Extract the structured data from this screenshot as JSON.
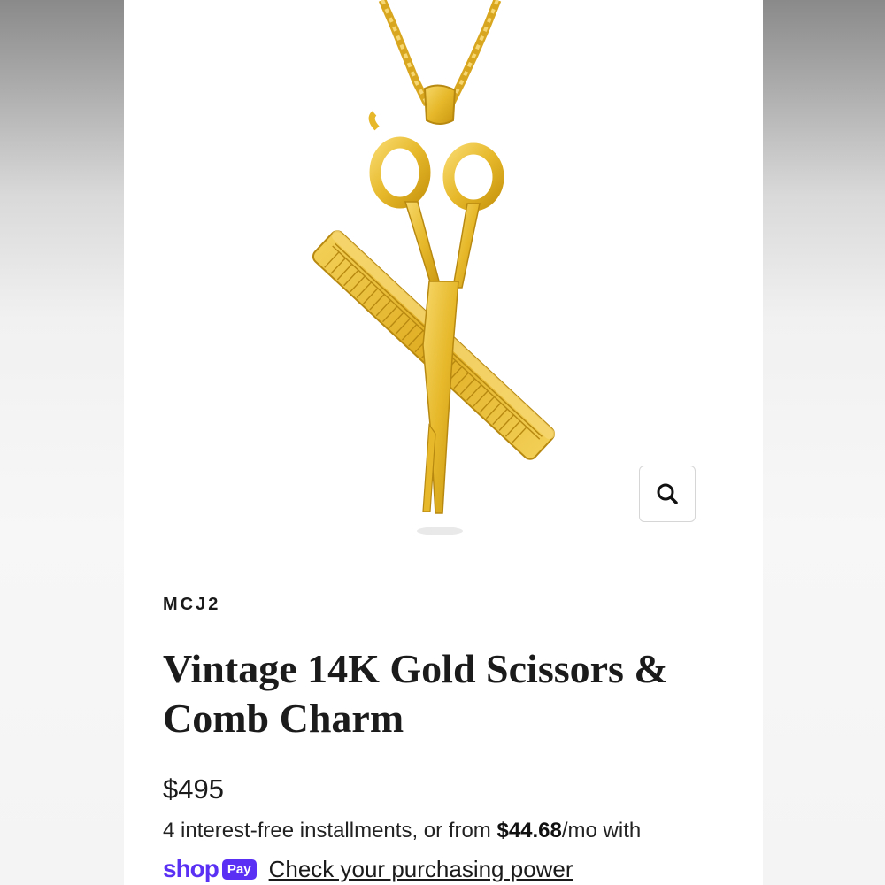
{
  "product": {
    "vendor": "MCJ2",
    "title": "Vintage 14K Gold Scissors & Comb Charm",
    "price": "$495",
    "image_alt": "Gold scissors and comb charm on box chain"
  },
  "installments": {
    "prefix": "4 interest-free installments, or from ",
    "amount": "$44.68",
    "suffix": "/mo with"
  },
  "shop_pay": {
    "logo_text": "shop",
    "badge_text": "Pay",
    "link_label": "Check your purchasing power",
    "brand_color": "#5a31f4"
  },
  "zoom": {
    "icon": "search-icon"
  },
  "colors": {
    "gold": "#e6b82a",
    "gold_dark": "#b88910",
    "text": "#1a1a1a"
  }
}
